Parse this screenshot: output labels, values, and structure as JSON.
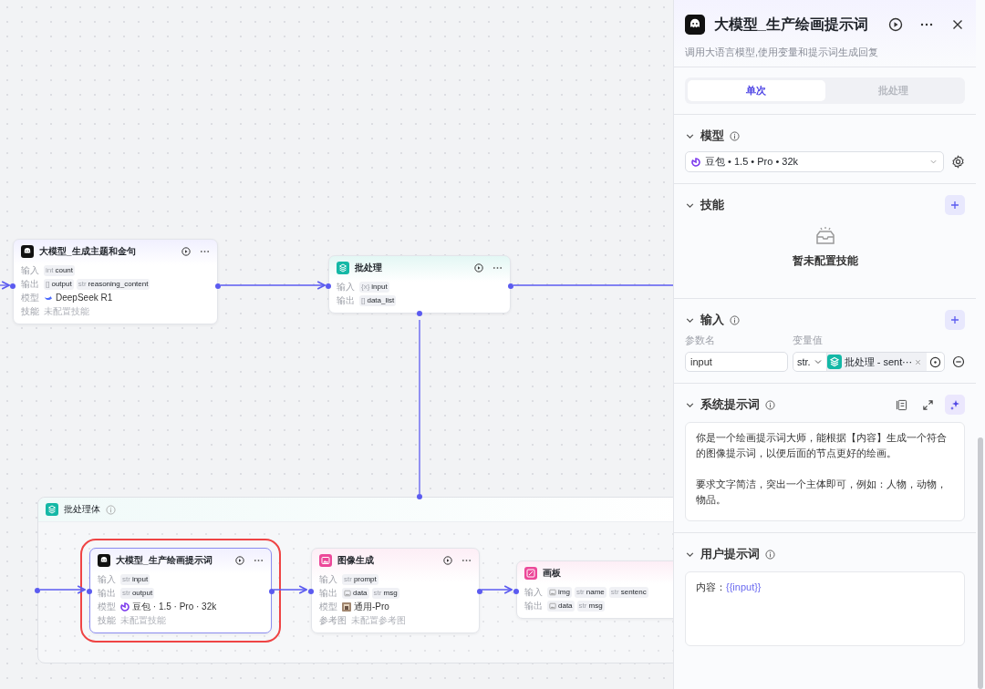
{
  "canvas": {
    "nodes": [
      {
        "title": "大模型_生成主题和金句",
        "selected": false,
        "rows": [
          {
            "kind": "ports",
            "label": "输入",
            "ports": [
              {
                "kind": "typed",
                "type": "int",
                "name": "count"
              }
            ]
          },
          {
            "kind": "ports",
            "label": "输出",
            "ports": [
              {
                "kind": "typed",
                "type": "[]",
                "name": "output"
              },
              {
                "kind": "typed",
                "type": "str",
                "name": "reasoning_content"
              }
            ]
          },
          {
            "kind": "model",
            "label": "模型",
            "value": "DeepSeek R1"
          },
          {
            "kind": "text",
            "label": "技能",
            "value": "未配置技能"
          }
        ]
      },
      {
        "title": "批处理",
        "selected": false,
        "rows": [
          {
            "kind": "ports",
            "label": "输入",
            "ports": [
              {
                "kind": "typed",
                "type": "{x}",
                "name": "input"
              }
            ]
          },
          {
            "kind": "ports",
            "label": "输出",
            "ports": [
              {
                "kind": "typed",
                "type": "[]",
                "name": "data_list"
              }
            ]
          }
        ]
      }
    ],
    "batch_body": {
      "title": "批处理体",
      "nodes": [
        {
          "title": "大模型_生产绘画提示词",
          "selected": true,
          "rows": [
            {
              "kind": "ports",
              "label": "输入",
              "ports": [
                {
                  "kind": "typed",
                  "type": "str",
                  "name": "input"
                }
              ]
            },
            {
              "kind": "ports",
              "label": "输出",
              "ports": [
                {
                  "kind": "typed",
                  "type": "str",
                  "name": "output"
                }
              ]
            },
            {
              "kind": "model",
              "label": "模型",
              "value": "豆包 · 1.5 · Pro · 32k"
            },
            {
              "kind": "text",
              "label": "技能",
              "value": "未配置技能"
            }
          ]
        },
        {
          "title": "图像生成",
          "selected": false,
          "rows": [
            {
              "kind": "ports",
              "label": "输入",
              "ports": [
                {
                  "kind": "typed",
                  "type": "str",
                  "name": "prompt"
                }
              ]
            },
            {
              "kind": "ports",
              "label": "输出",
              "ports": [
                {
                  "kind": "image",
                  "name": "data"
                },
                {
                  "kind": "typed",
                  "type": "str",
                  "name": "msg"
                }
              ]
            },
            {
              "kind": "model",
              "label": "模型",
              "value": "通用-Pro"
            },
            {
              "kind": "text",
              "label": "参考图",
              "value": "未配置参考图"
            }
          ]
        },
        {
          "title": "画板",
          "selected": false,
          "rows": [
            {
              "kind": "ports",
              "label": "输入",
              "ports": [
                {
                  "kind": "image",
                  "name": "img"
                },
                {
                  "kind": "typed",
                  "type": "str",
                  "name": "name"
                },
                {
                  "kind": "typed",
                  "type": "str",
                  "name": "sentenc"
                }
              ]
            },
            {
              "kind": "ports",
              "label": "输出",
              "ports": [
                {
                  "kind": "image",
                  "name": "data"
                },
                {
                  "kind": "typed",
                  "type": "str",
                  "name": "msg"
                }
              ]
            }
          ]
        }
      ]
    }
  },
  "panel": {
    "title": "大模型_生产绘画提示词",
    "description": "调用大语言模型,使用变量和提示词生成回复",
    "tabs": [
      {
        "label": "单次",
        "selected": true
      },
      {
        "label": "批处理",
        "selected": false
      }
    ],
    "model": {
      "title": "模型",
      "expanded": true,
      "value": "豆包 • 1.5 • Pro • 32k"
    },
    "skills": {
      "title": "技能",
      "expanded": true,
      "empty_text": "暂未配置技能"
    },
    "inputs": {
      "title": "输入",
      "expanded": true,
      "columns": [
        "参数名",
        "变量值"
      ],
      "rows": [
        {
          "name": "input",
          "type": "str.",
          "reference": "批处理 - sent⋯"
        }
      ]
    },
    "system_prompt": {
      "title": "系统提示词",
      "expanded": true,
      "paragraphs": [
        "你是一个绘画提示词大师，能根据【内容】生成一个符合的图像提示词，以便后面的节点更好的绘画。",
        "要求文字简洁，突出一个主体即可，例如：人物，动物，物品。"
      ]
    },
    "user_prompt": {
      "title": "用户提示词",
      "expanded": true,
      "label": "内容：",
      "variable": "{{input}}"
    }
  }
}
